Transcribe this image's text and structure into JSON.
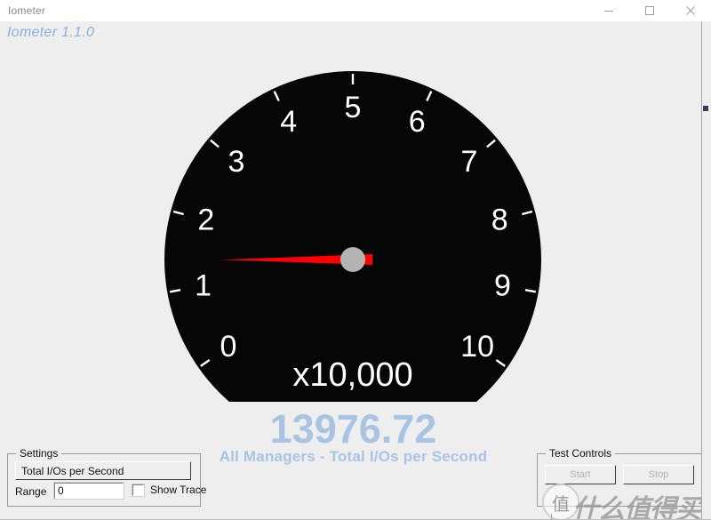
{
  "window": {
    "title": "Iometer",
    "controls": {
      "minimize": "minimize-icon",
      "maximize": "maximize-icon",
      "close": "close-icon"
    }
  },
  "app": {
    "version_label": "Iometer 1.1.0"
  },
  "gauge": {
    "tick_labels": [
      "0",
      "1",
      "2",
      "3",
      "4",
      "5",
      "6",
      "7",
      "8",
      "9",
      "10"
    ],
    "multiplier_label": "x10,000",
    "dial_color": "#060606",
    "tick_color": "#ffffff",
    "needle_color": "#ff0000",
    "hub_color": "#b4b4b4",
    "min": 0,
    "max": 10,
    "needle_value": 1.3976
  },
  "readout": {
    "value": "13976.72",
    "label": "All Managers - Total I/Os per Second",
    "color": "#a8c4e2"
  },
  "settings": {
    "group_title": "Settings",
    "metric_button": "Total I/Os per Second",
    "range_label": "Range",
    "range_value": "0",
    "range_placeholder": "0",
    "show_trace_label": "Show Trace",
    "show_trace_checked": false
  },
  "test_controls": {
    "group_title": "Test Controls",
    "start_label": "Start",
    "stop_label": "Stop"
  },
  "watermark": {
    "logo_glyph": "值",
    "text": "什么值得买"
  }
}
